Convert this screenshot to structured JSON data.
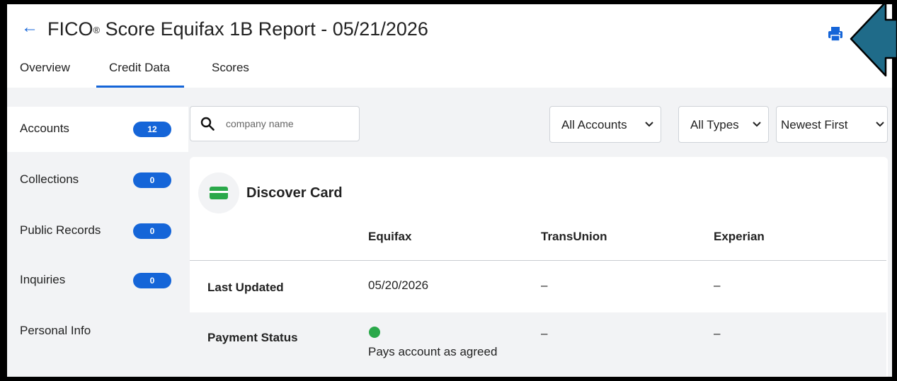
{
  "header": {
    "back_glyph": "←",
    "title_prefix": "FICO",
    "title_reg": "®",
    "title_suffix": " Score Equifax 1B Report - 05/21/2026",
    "print_icon": "print-icon"
  },
  "tabs": [
    {
      "label": "Overview",
      "active": false
    },
    {
      "label": "Credit Data",
      "active": true
    },
    {
      "label": "Scores",
      "active": false
    }
  ],
  "sidebar": {
    "items": [
      {
        "label": "Accounts",
        "count": "12",
        "active": true
      },
      {
        "label": "Collections",
        "count": "0",
        "active": false
      },
      {
        "label": "Public Records",
        "count": "0",
        "active": false
      },
      {
        "label": "Inquiries",
        "count": "0",
        "active": false
      },
      {
        "label": "Personal Info",
        "count": null,
        "active": false
      }
    ]
  },
  "search": {
    "placeholder": "company name",
    "value": ""
  },
  "filters": {
    "accounts": "All Accounts",
    "types": "All Types",
    "sort": "Newest First"
  },
  "account": {
    "name": "Discover Card",
    "icon": "credit-card-icon",
    "bureaus": [
      "Equifax",
      "TransUnion",
      "Experian"
    ],
    "rows": [
      {
        "label": "Last Updated",
        "values": [
          "05/20/2026",
          "–",
          "–"
        ]
      },
      {
        "label": "Payment Status",
        "values": [
          "Pays account as agreed",
          "–",
          "–"
        ]
      }
    ]
  },
  "colors": {
    "accent": "#1565d8",
    "status_ok": "#2aa84a",
    "card_icon": "#2aa84a",
    "annotation_arrow": "#1f6b89"
  }
}
